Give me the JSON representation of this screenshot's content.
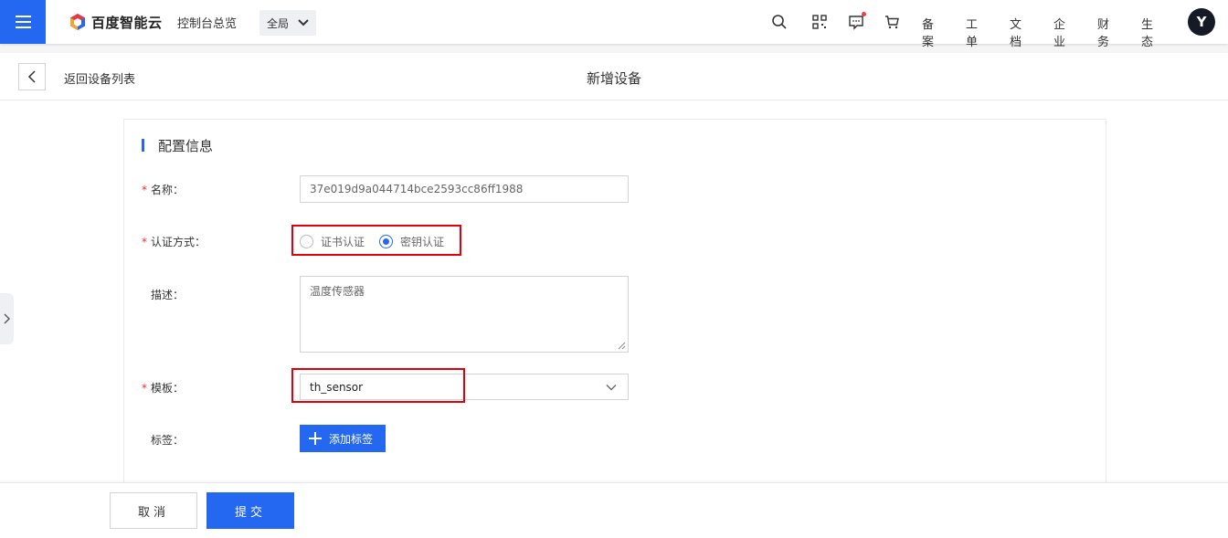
{
  "topbar": {
    "brand": "百度智能云",
    "console_overview": "控制台总览",
    "region": "全局",
    "links": [
      "备案",
      "工单",
      "文档",
      "企业",
      "财务",
      "生态"
    ],
    "avatar_initial": "Y",
    "accent_color": "#2468f2"
  },
  "subheader": {
    "back_label": "返回设备列表",
    "title": "新增设备"
  },
  "form": {
    "section_title": "配置信息",
    "name": {
      "label": "名称：",
      "value": "37e019d9a044714bce2593cc86ff1988",
      "required": true
    },
    "auth": {
      "label": "认证方式：",
      "required": true,
      "options": [
        {
          "label": "证书认证",
          "checked": false
        },
        {
          "label": "密钥认证",
          "checked": true
        }
      ]
    },
    "description": {
      "label": "描述：",
      "value": "温度传感器"
    },
    "template": {
      "label": "模板：",
      "value": "th_sensor",
      "required": true
    },
    "tags": {
      "label": "标签：",
      "add_button": "添加标签"
    }
  },
  "footer": {
    "cancel": "取消",
    "submit": "提交"
  },
  "colors": {
    "primary": "#2468f2",
    "required": "#ea2e2e",
    "highlight": "#e3000b"
  }
}
